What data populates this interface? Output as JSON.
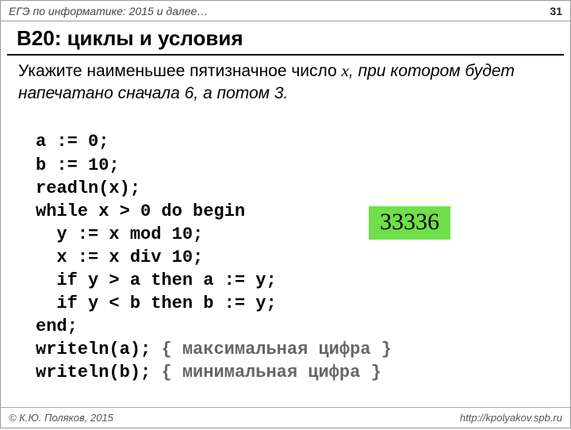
{
  "header": {
    "left": "ЕГЭ по информатике: 2015 и далее…",
    "right": "31"
  },
  "title": "B20: циклы и условия",
  "task": {
    "pre": "Укажите наименьшее пятизначное число ",
    "var": "x",
    "post": ", при котором будет напечатано сначала 6, а потом 3."
  },
  "code": {
    "l1": "a := 0;",
    "l2": "b := 10;",
    "l3": "readln(x);",
    "l4": "while x > 0 do begin",
    "l5": "  y := x mod 10;",
    "l6": "  x := x div 10;",
    "l7": "  if y > a then a := y;",
    "l8": "  if y < b then b := y;",
    "l9": "end;",
    "l10a": "writeln(a); ",
    "l10c": "{ максимальная цифра }",
    "l11a": "writeln(b); ",
    "l11c": "{ минимальная цифра }"
  },
  "answer": "33336",
  "footer": {
    "copy": "© К.Ю. Поляков, 2015",
    "url": "http://kpolyakov.spb.ru"
  }
}
